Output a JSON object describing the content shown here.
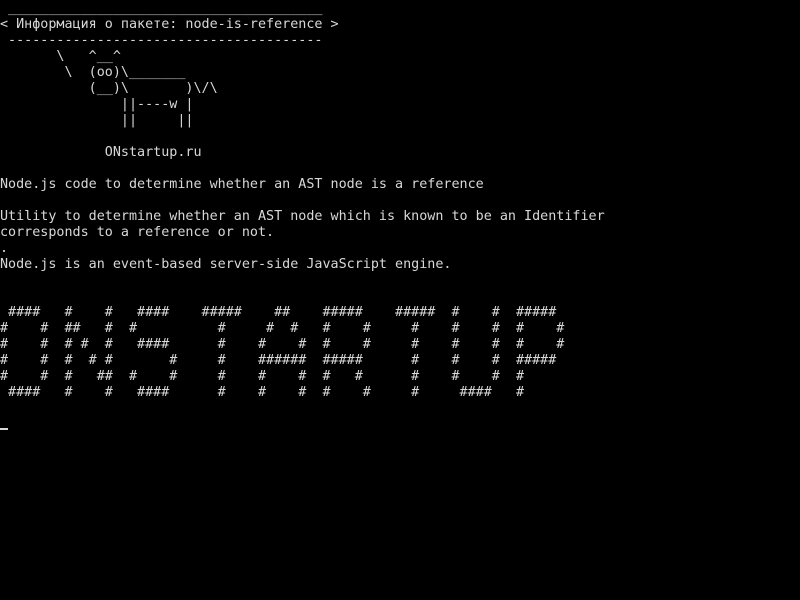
{
  "terminal": {
    "box_top": " _______________________________________",
    "box_title": "< Информация о пакете: node-is-reference >",
    "box_bottom": " ---------------------------------------",
    "cow": [
      "       \\   ^__^",
      "        \\  (oo)\\_______",
      "           (__)\\       )\\/\\",
      "               ||----w |",
      "               ||     ||"
    ],
    "site": "             ONstartup.ru",
    "summary": "Node.js code to determine whether an AST node is a reference",
    "description_1": "Utility to determine whether an AST node which is known to be an Identifier",
    "description_2": "corresponds to a reference or not.",
    "dot": ".",
    "engine": "Node.js is an event-based server-side JavaScript engine.",
    "banner": [
      " ####   #    #   ####    #####    ##    #####    #####  #    #  #####",
      "#    #  ##   #  #          #     #  #   #    #     #    #    #  #    #",
      "#    #  # #  #   ####      #    #    #  #    #     #    #    #  #    #",
      "#    #  #  # #       #     #    ######  #####      #    #    #  #####",
      "#    #  #   ##  #    #     #    #    #  #   #      #    #    #  #",
      " ####   #    #   ####      #    #    #  #    #     #     ####   #"
    ]
  }
}
